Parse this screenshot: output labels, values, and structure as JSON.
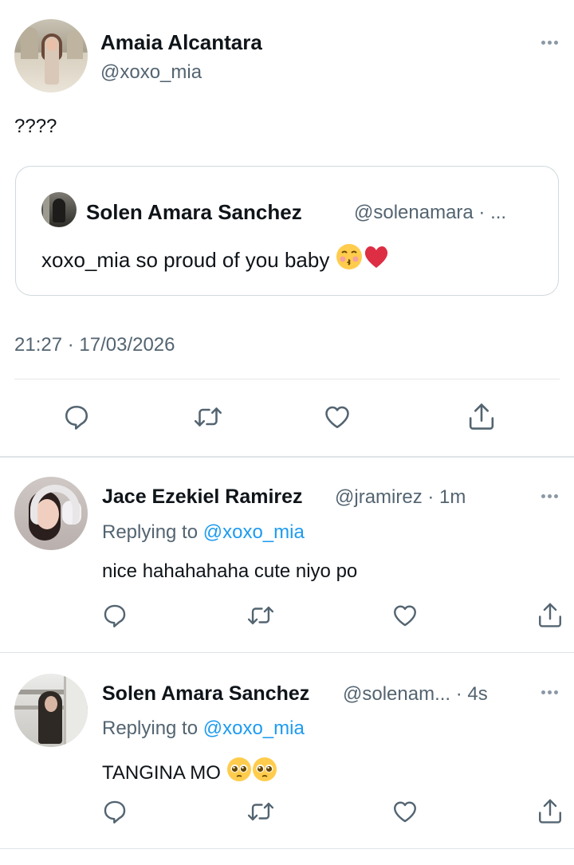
{
  "main_tweet": {
    "author_name": "Amaia Alcantara",
    "author_handle": "@xoxo_mia",
    "text": "????",
    "timestamp": "21:27 · 17/03/2026",
    "quoted": {
      "author_name": "Solen Amara Sanchez",
      "author_handle_and_time": "@solenamara · ...",
      "text": "xoxo_mia so proud of you baby",
      "emojis": [
        "kissing-face-emoji",
        "red-heart-emoji"
      ]
    },
    "actions": [
      "reply-icon",
      "retweet-icon",
      "like-icon",
      "share-icon"
    ]
  },
  "replies": [
    {
      "author_name": "Jace Ezekiel Ramirez",
      "author_handle_and_time": "@jramirez · 1m",
      "replying_prefix": "Replying to",
      "replying_to": "@xoxo_mia",
      "text": "nice hahahahaha cute niyo po"
    },
    {
      "author_name": "Solen Amara Sanchez",
      "author_handle_and_time": "@solenam... · 4s",
      "replying_prefix": "Replying to",
      "replying_to": "@xoxo_mia",
      "text": "TANGINA MO",
      "emojis": [
        "pleading-face-emoji",
        "pleading-face-emoji"
      ]
    }
  ],
  "colors": {
    "text": "#0f1419",
    "secondary": "#536471",
    "link": "#1d9bf0",
    "border": "#cfd9de"
  }
}
